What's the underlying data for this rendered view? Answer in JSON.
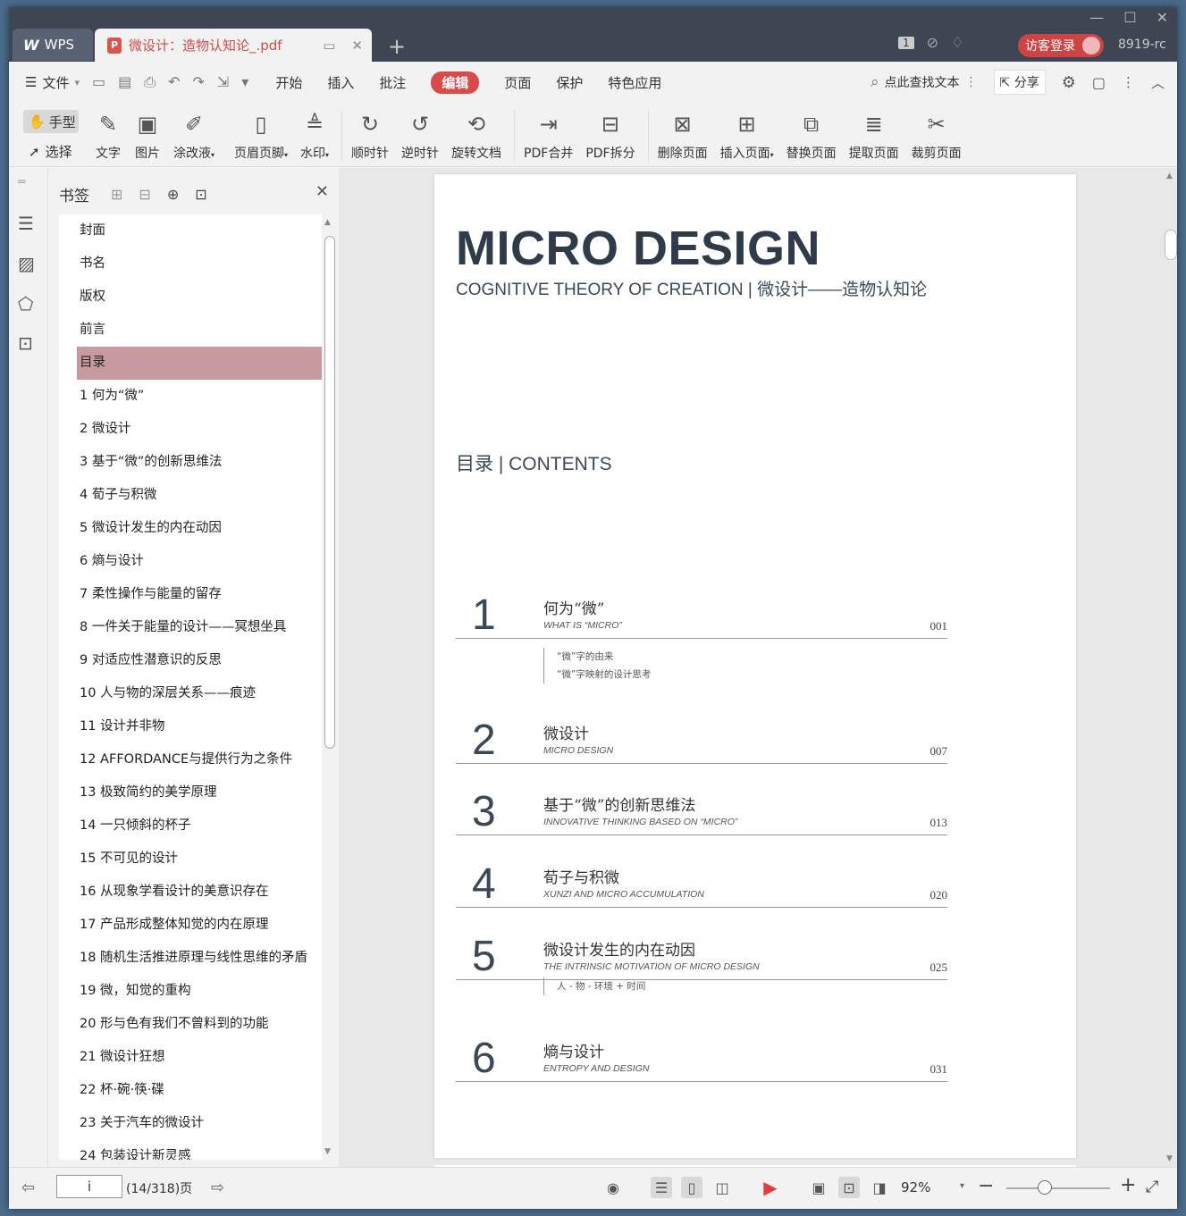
{
  "app": {
    "name": "WPS",
    "doc_tab_title": "微设计：造物认知论_.pdf",
    "user_id": "8919-rc",
    "login_label": "访客登录",
    "badge_count": "1"
  },
  "menu": {
    "file_label": "文件",
    "tabs": [
      "开始",
      "插入",
      "批注",
      "编辑",
      "页面",
      "保护",
      "特色应用"
    ],
    "active_tab": "编辑",
    "find_label": "点此查找文本",
    "share_label": "分享"
  },
  "ribbon": {
    "hand_label": "手型",
    "select_label": "选择",
    "tools": [
      {
        "label": "文字",
        "icon": "text-edit-icon"
      },
      {
        "label": "图片",
        "icon": "image-edit-icon"
      },
      {
        "label": "涂改液",
        "icon": "correction-pen-icon"
      },
      {
        "label": "页眉页脚",
        "icon": "header-footer-icon"
      },
      {
        "label": "水印",
        "icon": "watermark-icon"
      },
      {
        "label": "顺时针",
        "icon": "rotate-cw-icon"
      },
      {
        "label": "逆时针",
        "icon": "rotate-ccw-icon"
      },
      {
        "label": "旋转文档",
        "icon": "rotate-doc-icon"
      },
      {
        "label": "PDF合并",
        "icon": "pdf-merge-icon"
      },
      {
        "label": "PDF拆分",
        "icon": "pdf-split-icon"
      },
      {
        "label": "删除页面",
        "icon": "delete-page-icon"
      },
      {
        "label": "插入页面",
        "icon": "insert-page-icon"
      },
      {
        "label": "替换页面",
        "icon": "replace-page-icon"
      },
      {
        "label": "提取页面",
        "icon": "extract-page-icon"
      },
      {
        "label": "裁剪页面",
        "icon": "crop-page-icon"
      }
    ]
  },
  "bookmarks": {
    "title": "书签",
    "active_index": 4,
    "items": [
      "封面",
      "书名",
      "版权",
      "前言",
      "目录",
      "1  何为“微”",
      "2  微设计",
      "3  基于“微”的创新思维法",
      "4  荀子与积微",
      "5  微设计发生的内在动因",
      "6  熵与设计",
      "7  柔性操作与能量的留存",
      "8  一件关于能量的设计——冥想坐具",
      "9  对适应性潜意识的反思",
      "10  人与物的深层关系——痕迹",
      "11  设计并非物",
      "12  AFFORDANCE与提供行为之条件",
      "13  极致简约的美学原理",
      "14  一只倾斜的杯子",
      "15  不可见的设计",
      "16  从现象学看设计的美意识存在",
      "17  产品形成整体知觉的内在原理",
      "18  随机生活推进原理与线性思维的矛盾",
      "19  微，知觉的重构",
      "20  形与色有我们不曾料到的功能",
      "21  微设计狂想",
      "22  杯·碗·筷·碟",
      "23  关于汽车的微设计",
      "24  包装设计新灵感"
    ]
  },
  "page_content": {
    "title": "MICRO DESIGN",
    "subtitle": "COGNITIVE THEORY OF CREATION | 微设计——造物认知论",
    "contents_heading": "目录 | CONTENTS",
    "toc": [
      {
        "num": "1",
        "cn": "何为“微”",
        "en": "WHAT IS “MICRO”",
        "page": "001",
        "subs": [
          "“微”字的由来",
          "“微”字映射的设计思考"
        ]
      },
      {
        "num": "2",
        "cn": "微设计",
        "en": "MICRO DESIGN",
        "page": "007",
        "subs": []
      },
      {
        "num": "3",
        "cn": "基于“微”的创新思维法",
        "en": "INNOVATIVE THINKING BASED ON “MICRO”",
        "page": "013",
        "subs": []
      },
      {
        "num": "4",
        "cn": "荀子与积微",
        "en": "XUNZI AND MICRO ACCUMULATION",
        "page": "020",
        "subs": []
      },
      {
        "num": "5",
        "cn": "微设计发生的内在动因",
        "en": "THE INTRINSIC MOTIVATION OF MICRO DESIGN",
        "page": "025",
        "subs": [
          "人 - 物 - 环境 + 时间"
        ]
      },
      {
        "num": "6",
        "cn": "熵与设计",
        "en": "ENTROPY AND DESIGN",
        "page": "031",
        "subs": []
      }
    ]
  },
  "status": {
    "page_input": "i",
    "page_count": "(14/318)页",
    "zoom": "92%",
    "zoom_level_fraction": 0.37
  }
}
